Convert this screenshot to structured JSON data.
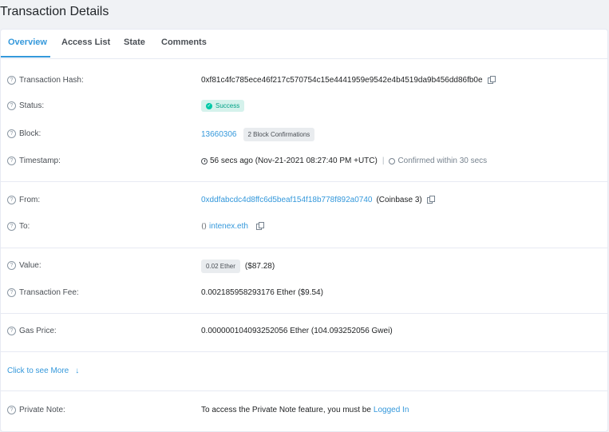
{
  "page": {
    "title": "Transaction Details"
  },
  "tabs": [
    {
      "label": "Overview"
    },
    {
      "label": "Access List"
    },
    {
      "label": "State"
    },
    {
      "label": "Comments"
    }
  ],
  "rows": {
    "tx_hash": {
      "label": "Transaction Hash:",
      "value": "0xf81c4fc785ece46f217c570754c15e4441959e9542e4b4519da9b456dd86fb0e"
    },
    "status": {
      "label": "Status:",
      "value": "Success"
    },
    "block": {
      "label": "Block:",
      "value": "13660306",
      "confirmations": "2 Block Confirmations"
    },
    "timestamp": {
      "label": "Timestamp:",
      "value": "56 secs ago (Nov-21-2021 08:27:40 PM +UTC)",
      "separator": "|",
      "confirmed": "Confirmed within 30 secs"
    },
    "from": {
      "label": "From:",
      "address": "0xddfabcdc4d8ffc6d5beaf154f18b778f892a0740",
      "name": "(Coinbase 3)"
    },
    "to": {
      "label": "To:",
      "value": "intenex.eth"
    },
    "value": {
      "label": "Value:",
      "badge": "0.02 Ether",
      "usd": "($87.28)"
    },
    "fee": {
      "label": "Transaction Fee:",
      "value": "0.002185958293176 Ether ($9.54)"
    },
    "gas_price": {
      "label": "Gas Price:",
      "value": "0.000000104093252056 Ether (104.093252056 Gwei)"
    },
    "private_note": {
      "label": "Private Note:",
      "text": "To access the Private Note feature, you must be",
      "link": "Logged In"
    }
  },
  "see_more": {
    "label": "Click to see More",
    "arrow": "↓"
  },
  "colors": {
    "accent": "#3498db",
    "success": "#00c9a7",
    "background": "#f0f2f5"
  }
}
